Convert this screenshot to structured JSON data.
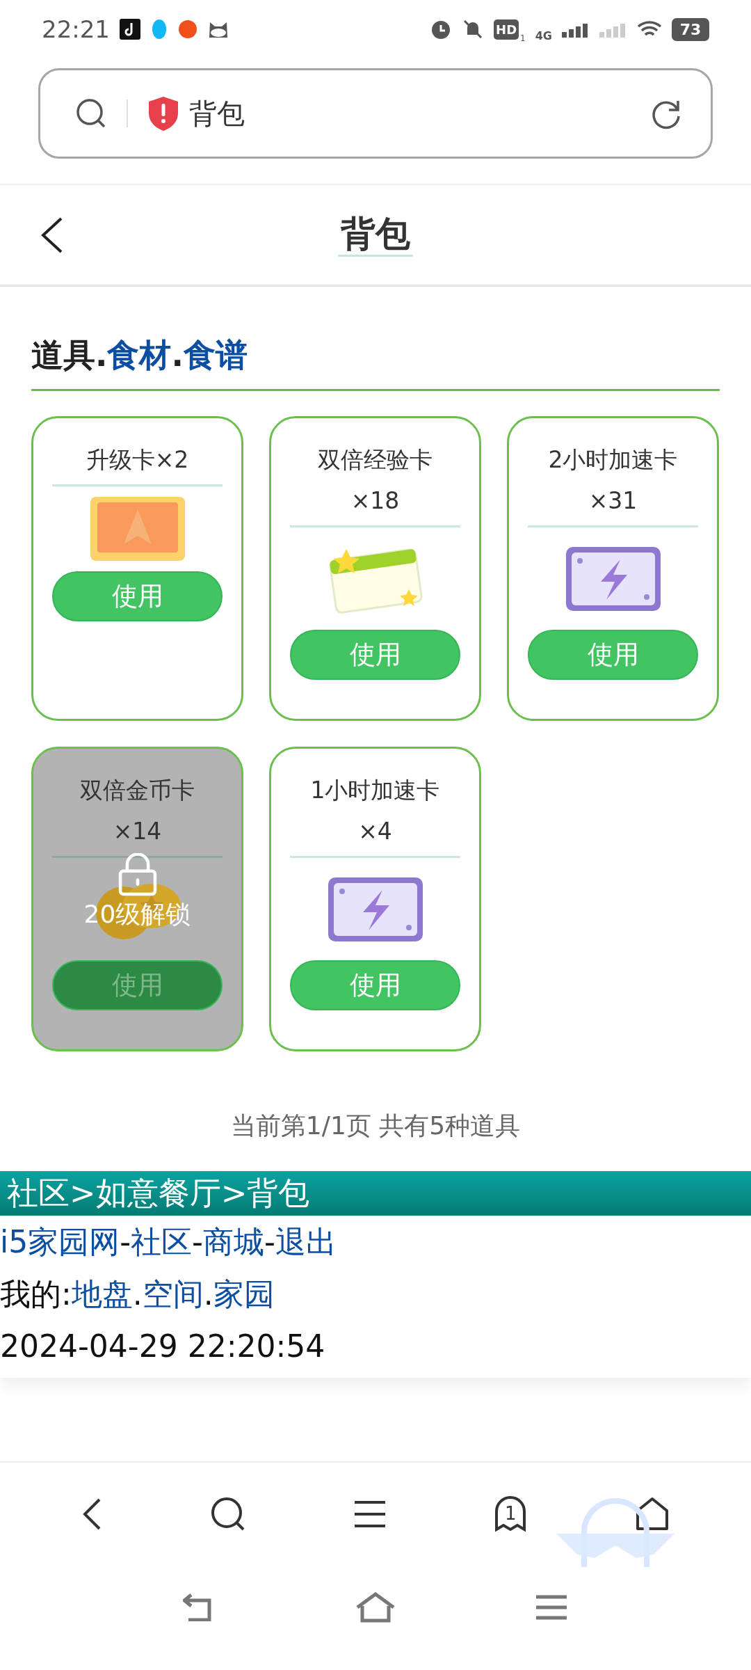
{
  "status_bar": {
    "time": "22:21",
    "hd": "HD",
    "hd_sub": "1",
    "network": "4G",
    "battery": "73"
  },
  "address_bar": {
    "text": "背包"
  },
  "header": {
    "title": "背包"
  },
  "category_tabs": {
    "separator": ".",
    "items": [
      {
        "label": "道具",
        "selected": true
      },
      {
        "label": "食材",
        "selected": false
      },
      {
        "label": "食谱",
        "selected": false
      }
    ]
  },
  "items": [
    {
      "name": "升级卡",
      "count": "×2",
      "kind": "upgrade",
      "locked": false,
      "button": "使用"
    },
    {
      "name": "双倍经验卡",
      "count": "×18",
      "kind": "exp",
      "locked": false,
      "button": "使用"
    },
    {
      "name": "2小时加速卡",
      "count": "×31",
      "kind": "speed",
      "locked": false,
      "button": "使用"
    },
    {
      "name": "双倍金币卡",
      "count": "×14",
      "kind": "coin",
      "locked": true,
      "lock_text": "20级解锁",
      "button": "使用"
    },
    {
      "name": "1小时加速卡",
      "count": "×4",
      "kind": "speed",
      "locked": false,
      "button": "使用"
    }
  ],
  "page_info": "当前第1/1页 共有5种道具",
  "breadcrumb": "社区>如意餐厅>背包",
  "footer_links": {
    "separator": "-",
    "items": [
      "i5家园网",
      "社区",
      "商城",
      "退出"
    ]
  },
  "my_links": {
    "prefix": "我的:",
    "separator": ".",
    "items": [
      "地盘",
      "空间",
      "家园"
    ]
  },
  "datetime": "2024-04-29 22:20:54",
  "browser_nav": {
    "tab_count": "1"
  }
}
